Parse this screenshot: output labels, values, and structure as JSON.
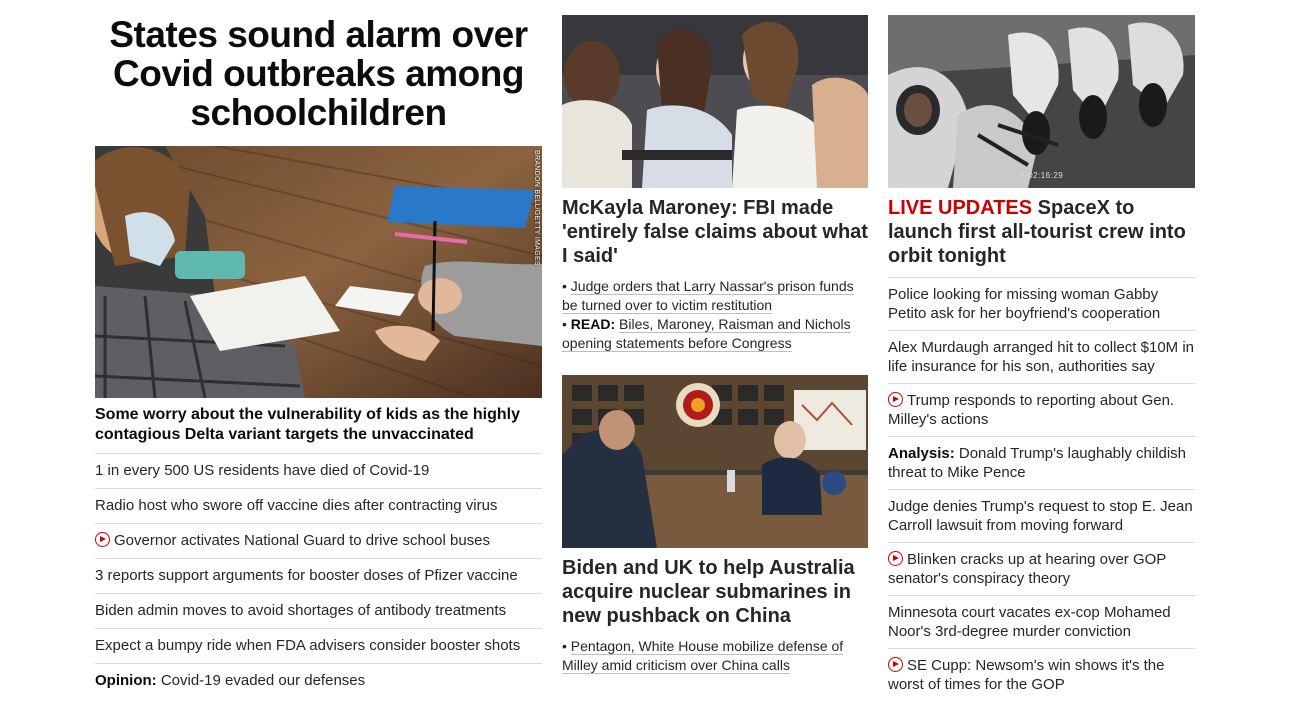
{
  "col1": {
    "headline": "States sound alarm over Covid outbreaks among schoolchildren",
    "photo_credit": "BRANDON BELL/GETTY IMAGES",
    "subhead": "Some worry about the vulnerability of kids as the highly contagious Delta variant targets the unvaccinated",
    "items": [
      {
        "text": "1 in every 500 US residents have died of Covid-19"
      },
      {
        "text": "Radio host who swore off vaccine dies after contracting virus"
      },
      {
        "text": "Governor activates National Guard to drive school buses",
        "video": true
      },
      {
        "text": "3 reports support arguments for booster doses of Pfizer vaccine"
      },
      {
        "text": "Biden admin moves to avoid shortages of antibody treatments"
      },
      {
        "text": "Expect a bumpy ride when FDA advisers consider booster shots"
      },
      {
        "label": "Opinion:",
        "text": "Covid-19 evaded our defenses"
      }
    ]
  },
  "col2": {
    "story1": {
      "title": "McKayla Maroney: FBI made 'entirely false claims about what I said'",
      "bullets": [
        {
          "prefix": "• ",
          "text": "Judge orders that Larry Nassar's prison funds be turned over to victim restitution"
        },
        {
          "prefix": "• ",
          "label": "READ:",
          "text": "Biles, Maroney, Raisman and Nichols opening statements before Congress"
        }
      ]
    },
    "story2": {
      "title": "Biden and UK to help Australia acquire nuclear submarines in new pushback on China",
      "bullets": [
        {
          "prefix": "• ",
          "text": "Pentagon, White House mobilize defense of Milley amid criticism over China calls"
        }
      ]
    }
  },
  "col3": {
    "photo_timer": "T-02:16:29",
    "live_label": "LIVE UPDATES",
    "title": "SpaceX to launch first all-tourist crew into orbit tonight",
    "items": [
      {
        "text": "Police looking for missing woman Gabby Petito ask for her boyfriend's cooperation"
      },
      {
        "text": "Alex Murdaugh arranged hit to collect $10M in life insurance for his son, authorities say"
      },
      {
        "text": "Trump responds to reporting about Gen. Milley's actions",
        "video": true
      },
      {
        "label": "Analysis:",
        "text": "Donald Trump's laughably childish threat to Mike Pence"
      },
      {
        "text": "Judge denies Trump's request to stop E. Jean Carroll lawsuit from moving forward"
      },
      {
        "text": "Blinken cracks up at hearing over GOP senator's conspiracy theory",
        "video": true
      },
      {
        "text": "Minnesota court vacates ex-cop Mohamed Noor's 3rd-degree murder conviction"
      },
      {
        "text": "SE Cupp: Newsom's win shows it's the worst of times for the GOP",
        "video": true
      }
    ]
  },
  "colors": {
    "accent_red": "#cc0000",
    "divider": "#dcdcdc",
    "text": "#262626"
  },
  "icons": {
    "video": "play-circle-icon"
  }
}
